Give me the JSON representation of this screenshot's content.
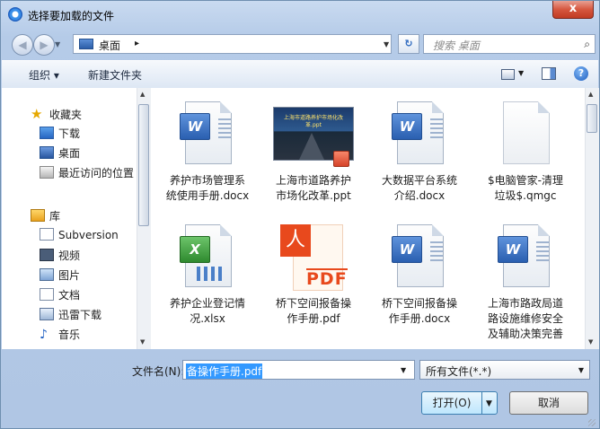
{
  "window": {
    "title": "选择要加载的文件",
    "close_glyph": "x"
  },
  "address": {
    "location": "桌面",
    "separator": "▸",
    "refresh_glyph": "↻",
    "search_placeholder": "搜索 桌面",
    "search_glyph": "⌕",
    "back_glyph": "◀",
    "forward_glyph": "▶"
  },
  "toolbar": {
    "organize": "组织 ▾",
    "new_folder": "新建文件夹",
    "help_glyph": "?"
  },
  "nav": {
    "favorites": "收藏夹",
    "fav_items": [
      "下载",
      "桌面",
      "最近访问的位置"
    ],
    "libraries": "库",
    "lib_items": [
      "Subversion",
      "视频",
      "图片",
      "文档",
      "迅雷下载",
      "音乐"
    ],
    "star_glyph": "★",
    "music_glyph": "♪"
  },
  "files": [
    {
      "name": "养护市场管理系统使用手册.docx",
      "type": "word"
    },
    {
      "name": "上海市道路养护市场化改革.ppt",
      "type": "ppt"
    },
    {
      "name": "大数据平台系统介绍.docx",
      "type": "word"
    },
    {
      "name": "$电脑管家-清理垃圾$.qmgc",
      "type": "blank"
    },
    {
      "name": "养护企业登记情况.xlsx",
      "type": "excel"
    },
    {
      "name": "桥下空间报备操作手册.pdf",
      "type": "pdf"
    },
    {
      "name": "桥下空间报备操作手册.docx",
      "type": "word"
    },
    {
      "name": "上海市路政局道路设施维修安全及辅助决策完善",
      "type": "word"
    }
  ],
  "file_lines": [
    [
      "养护市场管理系",
      "统使用手册.docx"
    ],
    [
      "上海市道路养护",
      "市场化改革.ppt"
    ],
    [
      "大数据平台系统",
      "介绍.docx"
    ],
    [
      "$电脑管家-清理",
      "垃圾$.qmgc"
    ],
    [
      "养护企业登记情",
      "况.xlsx"
    ],
    [
      "桥下空间报备操",
      "作手册.pdf"
    ],
    [
      "桥下空间报备操",
      "作手册.docx"
    ],
    [
      "上海市路政局道",
      "路设施维修安全",
      "及辅助决策完善"
    ]
  ],
  "badges": {
    "word": "W",
    "excel": "X",
    "pdf_logo": "人",
    "pdf_text": "PDF"
  },
  "bottom": {
    "filename_label": "文件名(N):",
    "filename_value": "备操作手册.pdf",
    "filetype_value": "所有文件(*.*)",
    "open_label": "打开(O)",
    "cancel_label": "取消",
    "drop_glyph": "▼"
  },
  "colors": {
    "title_bar": "#c9daf0",
    "selection": "#3399ff",
    "close_button": "#d6573f"
  }
}
